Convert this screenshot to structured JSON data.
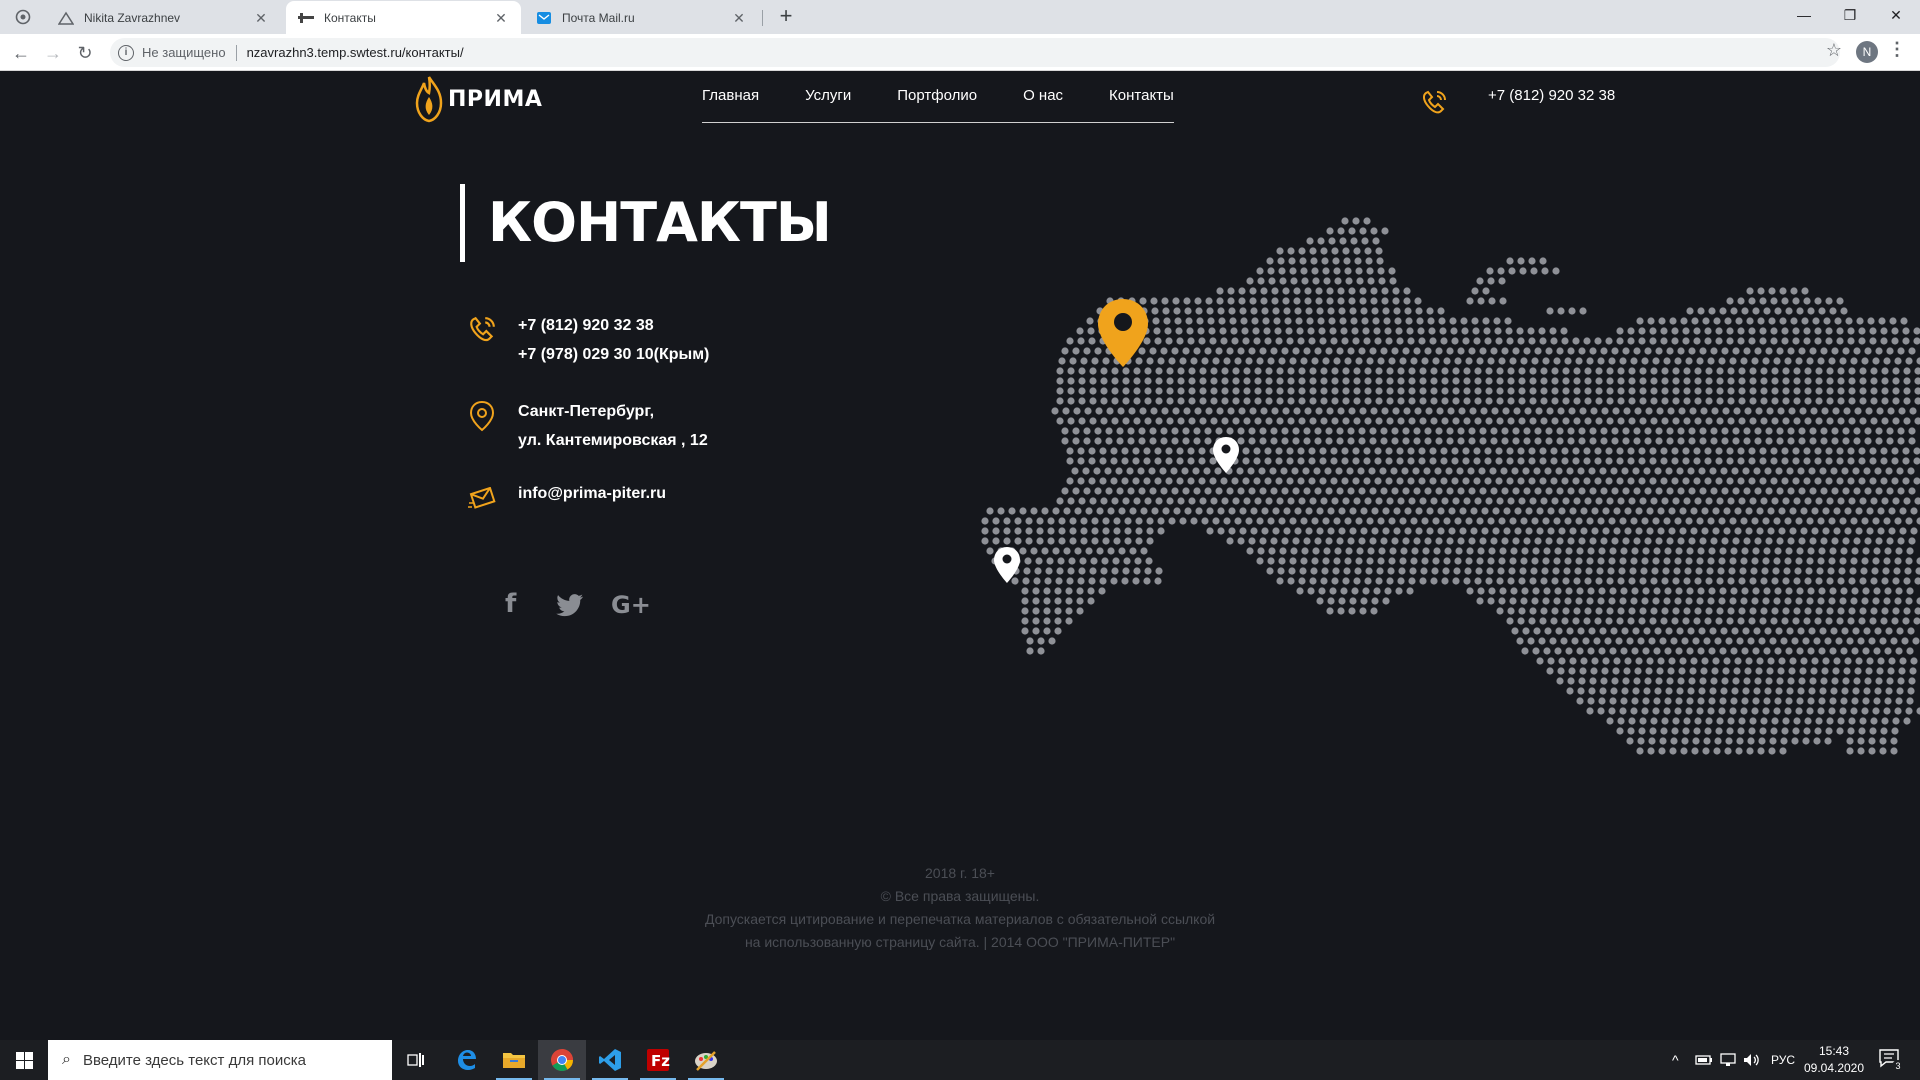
{
  "browser": {
    "tabs": [
      {
        "title": "Nikita Zavrazhnev",
        "active": false,
        "icon": "mountain-icon"
      },
      {
        "title": "Контакты",
        "active": true,
        "icon": "site-favicon"
      },
      {
        "title": "Почта Mail.ru",
        "active": false,
        "icon": "mail-icon"
      }
    ],
    "new_tab": "+",
    "security_label": "Не защищено",
    "url": "nzavrazhn3.temp.swtest.ru/контакты/",
    "profile_initial": "N"
  },
  "site": {
    "logo_text": "ПРИМА",
    "nav": [
      "Главная",
      "Услуги",
      "Портфолио",
      "О нас",
      "Контакты"
    ],
    "header_phone": "+7 (812) 920 32 38",
    "page_title": "КОНТАКТЫ",
    "phones": [
      "+7 (812) 920 32 38",
      "+7 (978) 029 30 10(Крым)"
    ],
    "address": [
      "Санкт-Петербург,",
      "ул. Кантемировская ,  12"
    ],
    "email": "info@prima-piter.ru",
    "social_icons": [
      "facebook-icon",
      "twitter-icon",
      "google-plus-icon"
    ],
    "social_glyphs": [
      "f",
      "t",
      "G+"
    ],
    "footer": [
      "2018 г. 18+",
      "© Все права защищены.",
      "Допускается цитирование и перепечатка материалов с обязательной ссылкой",
      "на использованную страницу сайта. | 2014 ООО \"ПРИМА-ПИТЕР\""
    ],
    "colors": {
      "accent": "#f0a31c",
      "background": "#15171c",
      "map_dot": "#8f9197"
    }
  },
  "taskbar": {
    "search_placeholder": "Введите здесь текст для поиска",
    "apps": [
      "task-view-icon",
      "edge-icon",
      "file-explorer-icon",
      "chrome-icon",
      "vscode-icon",
      "filezilla-icon",
      "paint-icon"
    ],
    "language": "РУС",
    "time": "15:43",
    "date": "09.04.2020",
    "notification_count": "3"
  }
}
